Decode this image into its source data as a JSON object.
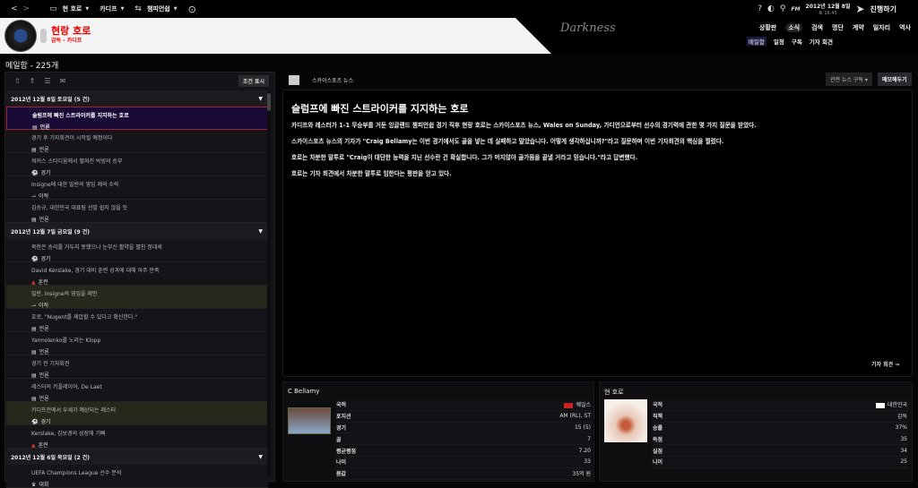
{
  "topbar": {
    "team": "현 호로",
    "club": "카디프",
    "competition": "챔피언쉽",
    "date": "2012년 12월 8일",
    "time": "토 16:45",
    "continue": "진행하기"
  },
  "header": {
    "manager_name": "현랑 호로",
    "manager_sub": "감독 - 카디프",
    "skin_label": "Darkness",
    "nav": [
      "상황판",
      "소식",
      "검색",
      "명단",
      "계약",
      "일자리",
      "역사"
    ],
    "nav_active": 1,
    "subnav": [
      "메일함",
      "일정",
      "구독",
      "기자 회견"
    ],
    "subnav_active": 0
  },
  "page_title": "메일함 - 225개",
  "inbox": {
    "filter_label": "조건 표시",
    "groups": [
      {
        "label": "2012년 12월 8일 토요일 (5 건)",
        "items": [
          {
            "title": "슬럼프에 빠진 스트라이커를 지지하는 호로",
            "category": "언론",
            "icon": "newspaper-icon",
            "state": "selected"
          },
          {
            "title": "경기 후 기자회견이 시작될 예정이다",
            "category": "언론",
            "icon": "newspaper-icon"
          },
          {
            "title": "워커스 스타디움에서 펼쳐진 박빙의 승부",
            "category": "경기",
            "icon": "ball-icon"
          },
          {
            "title": "Insigne에 대한 밀란의 영입 제의 수락",
            "category": "이적",
            "icon": "transfer-icon"
          },
          {
            "title": "김승규, 대한민국 대표팀 선발 쉽지 않을 듯",
            "category": "언론",
            "icon": "newspaper-icon"
          }
        ]
      },
      {
        "label": "2012년 12월 7일 금요일 (9 건)",
        "items": [
          {
            "title": "북한은 승리를 거두지 못했으나 눈부신 활약을 펼친 정대세",
            "category": "경기",
            "icon": "ball-icon"
          },
          {
            "title": "David Kerslake, 경기 대비 훈련 성과에 대해 아주 만족",
            "category": "훈련",
            "icon": "cone-icon"
          },
          {
            "title": "밀란, Insigne의 영입을 제안",
            "category": "이적",
            "icon": "transfer-icon",
            "state": "highlight"
          },
          {
            "title": "호로, \"Nugent를 제압할 수 있다고 확신한다.\"",
            "category": "언론",
            "icon": "newspaper-icon"
          },
          {
            "title": "Yarmolenko를 노리는 Klopp",
            "category": "언론",
            "icon": "newspaper-icon"
          },
          {
            "title": "경기 전 기자회견",
            "category": "언론",
            "icon": "newspaper-icon"
          },
          {
            "title": "레스터의 키플레이어, De Laet",
            "category": "언론",
            "icon": "newspaper-icon"
          },
          {
            "title": "카디프전에서 우세가 예상되는 레스터",
            "category": "경기",
            "icon": "ball-icon",
            "state": "highlight"
          },
          {
            "title": "Kerslake, 김보경의 성장에 기뻐",
            "category": "훈련",
            "icon": "cone-icon"
          }
        ]
      },
      {
        "label": "2012년 12월 6일 목요일 (2 건)",
        "items": [
          {
            "title": "UEFA Champions League 선수 분석",
            "category": "대회",
            "icon": "trophy-icon"
          }
        ]
      }
    ]
  },
  "news": {
    "source": "스카이스포츠 뉴스",
    "subscribe_label": "관련 뉴스 구독",
    "memo_label": "메모해두기",
    "title": "슬럼프에 빠진 스트라이커를 지지하는 호로",
    "paragraphs": [
      "카디프와 레스터가 1-1 무승부를 거둔 잉글랜드 챔피언쉽 경기 직후 현랑 호로는 스카이스포츠 뉴스, Wales on Sunday, 가디언으로부터 선수의 경기력에 관한 몇 가지 질문을 받았다.",
      "스카이스포츠 뉴스의 기자가 \"Craig Bellamy는 이번 경기에서도 골을 넣는 데 실패하고 말았습니다. 어떻게 생각하십니까?\"라고 질문하며 이번 기자회견의 핵심을 찔렀다.",
      "호로는 차분한 말투로 \"Craig이 대단한 능력을 지닌 선수란 건 확실합니다. 그가 머지않아 골가뭄을 끝낼 거라고 믿습니다.\"라고 답변했다.",
      "호로는 기자 회견에서 차분한 말투로 임한다는 평판을 얻고 있다."
    ],
    "press_link": "기자 회견 ⇒"
  },
  "player": {
    "name": "C Bellamy",
    "rows": [
      [
        "국적",
        "웨일스"
      ],
      [
        "포지션",
        "AM (RL), ST"
      ],
      [
        "경기",
        "15 (5)"
      ],
      [
        "골",
        "7"
      ],
      [
        "평균평점",
        "7.20"
      ],
      [
        "나이",
        "33"
      ],
      [
        "몸값",
        "35억 원"
      ]
    ]
  },
  "manager": {
    "name": "현 호로",
    "rows": [
      [
        "국적",
        "대한민국"
      ],
      [
        "직책",
        "감독"
      ],
      [
        "승률",
        "37%"
      ],
      [
        "득점",
        "35"
      ],
      [
        "실점",
        "34"
      ],
      [
        "나이",
        "25"
      ]
    ]
  }
}
